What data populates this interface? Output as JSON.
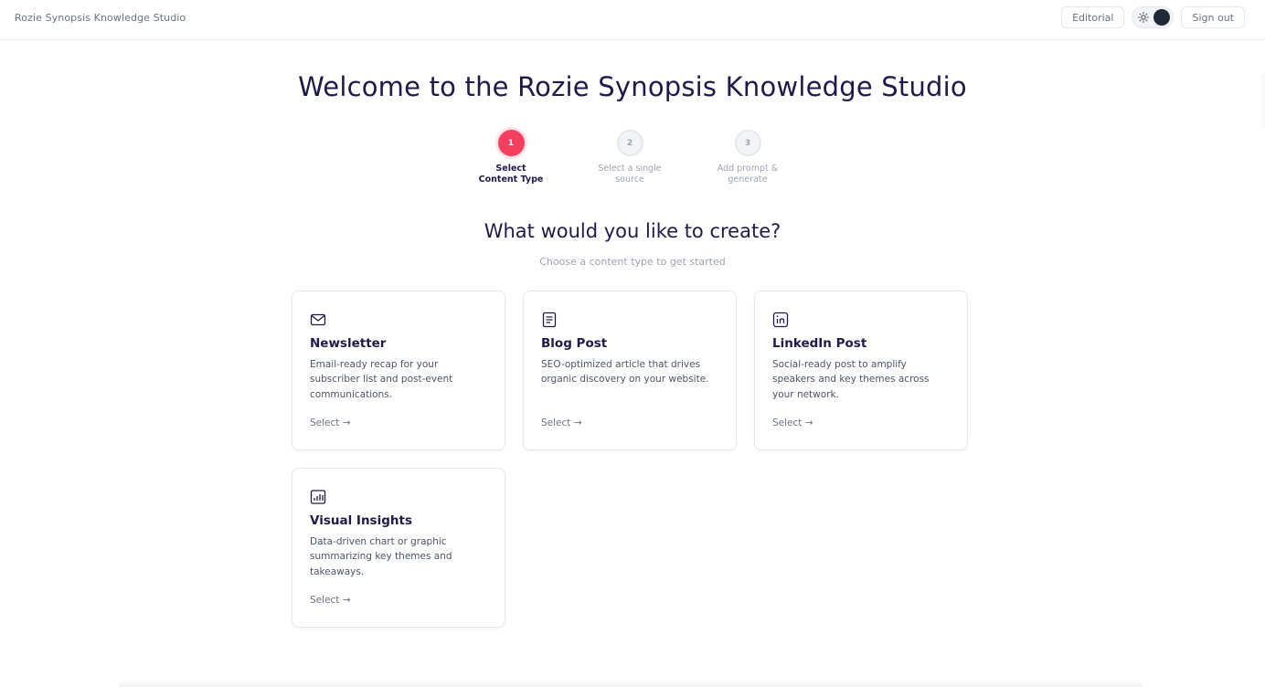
{
  "header": {
    "app_title": "Rozie Synopsis Knowledge Studio",
    "editorial_label": "Editorial",
    "signout_label": "Sign out",
    "theme_toggle": {
      "state": "dark",
      "icon": "sun-icon"
    }
  },
  "page": {
    "title": "Welcome to the Rozie Synopsis Knowledge Studio",
    "subtitle": "What would you like to create?",
    "caption": "Choose a content type to get started"
  },
  "steps": [
    {
      "number": "1",
      "label": "Select Content Type",
      "active": true
    },
    {
      "number": "2",
      "label": "Select a single source",
      "active": false
    },
    {
      "number": "3",
      "label": "Add prompt & generate",
      "active": false
    }
  ],
  "cards": [
    {
      "icon": "mail-icon",
      "title": "Newsletter",
      "description": "Email-ready recap for your subscriber list and post-event communications.",
      "action": "Select →"
    },
    {
      "icon": "document-icon",
      "title": "Blog Post",
      "description": "SEO-optimized article that drives organic discovery on your website.",
      "action": "Select →"
    },
    {
      "icon": "linkedin-icon",
      "title": "LinkedIn Post",
      "description": "Social-ready post to amplify speakers and key themes across your network.",
      "action": "Select →"
    },
    {
      "icon": "bar-chart-icon",
      "title": "Visual Insights",
      "description": "Data-driven chart or graphic summarizing key themes and takeaways.",
      "action": "Select →"
    }
  ],
  "colors": {
    "accent": "#f43f5e",
    "heading": "#1e1b4b",
    "muted": "#9ca3af",
    "border": "#e5e7eb"
  }
}
